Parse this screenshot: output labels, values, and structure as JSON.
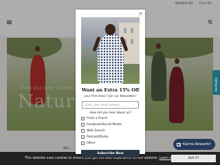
{
  "topbar": {
    "wishlist_label": "Wishlist (0)",
    "cart_label": "Cart (0)"
  },
  "hero": {
    "subtitle": "shop our new collection",
    "title": "Nature"
  },
  "below": {
    "text": "Wh..."
  },
  "reviews_tab": {
    "label": "REVIEWS"
  },
  "karma": {
    "label": "Karma Rewards!"
  },
  "cookie": {
    "message": "This website uses cookies to ensure you get the best experience on our website.",
    "learn_more": "Learn more",
    "button": "Got it!"
  },
  "popup": {
    "close_label": "×",
    "title": "Want an Extra 15% Off",
    "subtitle": "your first dress? Join our Newsletter!",
    "email_placeholder": "Enter your email address",
    "question": "How did you hear about us?",
    "options": [
      "From a friend",
      "Facebook/Social Media",
      "Web Search",
      "Podcast/Radio",
      "Other"
    ],
    "subscribe_label": "Subscribe Now"
  },
  "colors": {
    "subscribe_bg": "#2a3542",
    "karma_bg": "#263a5a",
    "reviews_bg": "#1f6e7a",
    "cookie_bg": "#222222"
  }
}
